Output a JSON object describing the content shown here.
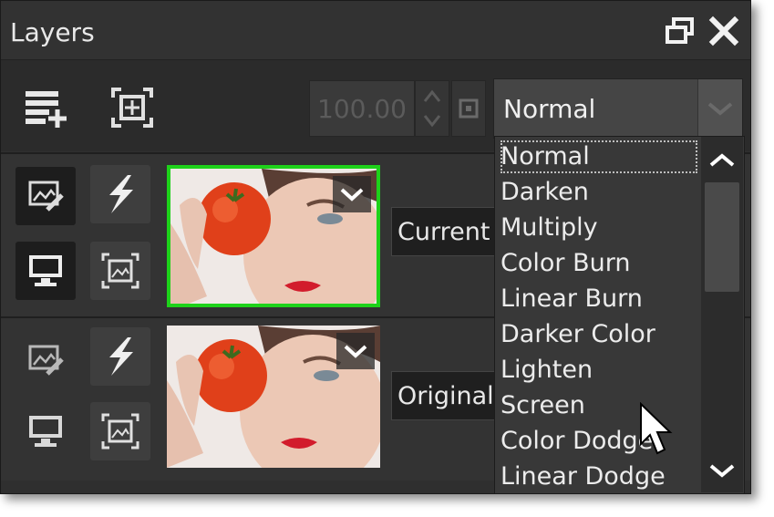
{
  "panel": {
    "title": "Layers"
  },
  "toolbar": {
    "opacity_value": "100.00",
    "blend_mode": "Normal"
  },
  "layers": [
    {
      "name": "Current",
      "selected": true
    },
    {
      "name": "Original",
      "selected": false
    }
  ],
  "blend_dropdown": {
    "items": [
      "Normal",
      "Darken",
      "Multiply",
      "Color Burn",
      "Linear Burn",
      "Darker Color",
      "Lighten",
      "Screen",
      "Color Dodge",
      "Linear Dodge"
    ],
    "focused_item": "Normal"
  },
  "icons": {
    "restore": "window-restore-icon",
    "close": "close-icon",
    "add_layer": "add-layer-icon",
    "fit": "fit-frame-icon",
    "edit": "edit-image-icon",
    "lightning": "lightning-icon",
    "monitor": "monitor-visibility-icon",
    "frame": "image-frame-icon"
  },
  "colors": {
    "selected_border": "#1ed21a",
    "panel_bg": "#2f2f2f"
  }
}
